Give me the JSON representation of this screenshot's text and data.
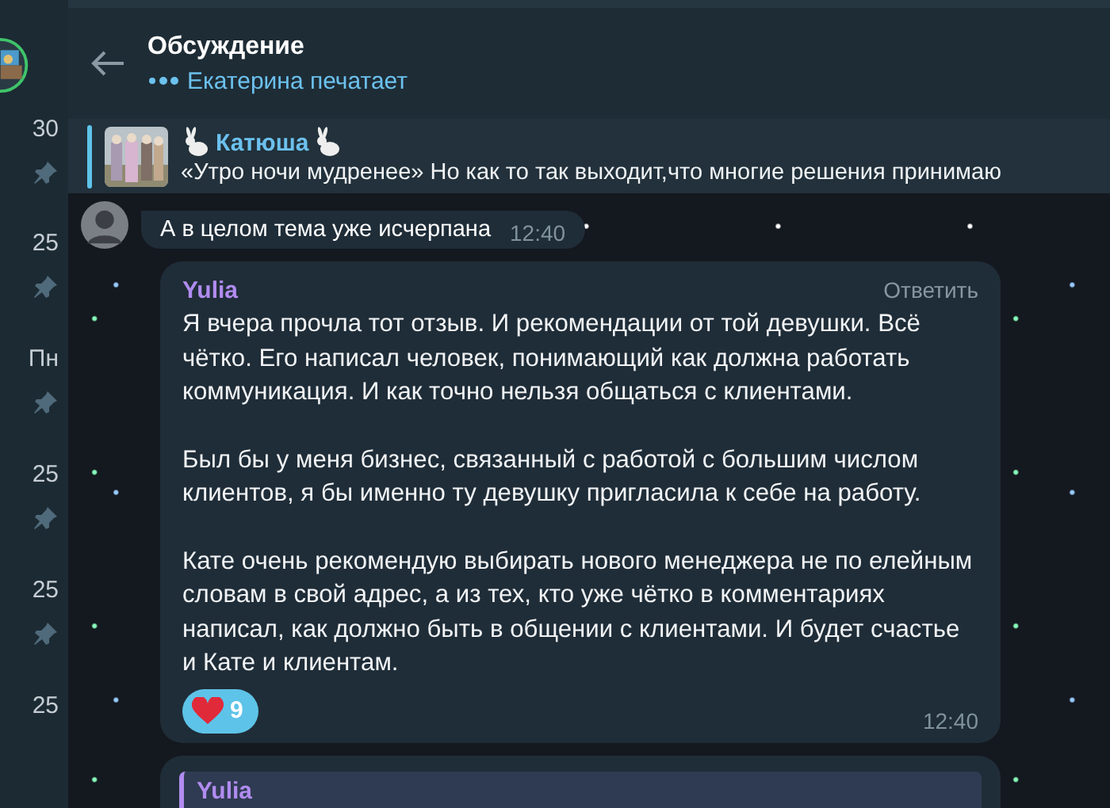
{
  "header": {
    "title": "Обсуждение",
    "status": "Екатерина печатает"
  },
  "sidebar": {
    "items": [
      {
        "time": "30",
        "pinned": true
      },
      {
        "time": "25",
        "pinned": true
      },
      {
        "time": "Пн",
        "pinned": true
      },
      {
        "time": "25",
        "pinned": true
      },
      {
        "time": "25",
        "pinned": true
      },
      {
        "time": "25",
        "pinned": false
      }
    ]
  },
  "pinned": {
    "name": "Катюша",
    "text": "«Утро ночи мудренее»  Но как то так выходит,что многие решения принимаю"
  },
  "messages": [
    {
      "kind": "partial",
      "text": "А в целом тема уже исчерпана",
      "time": "12:40"
    },
    {
      "kind": "full",
      "author": "Yulia",
      "reply_label": "Ответить",
      "paragraphs": [
        "Я вчера прочла тот отзыв. И рекомендации от той девушки. Всё чётко. Его написал человек, понимающий как должна работать коммуникация. И как точно нельзя общаться с клиентами.",
        "Был бы у меня бизнес, связанный с работой с большим числом клиентов, я бы именно ту девушку пригласила к себе на работу.",
        "Кате очень рекомендую выбирать нового менеджера не по елейным словам в свой адрес, а из тех, кто уже чётко в комментариях написал, как должно быть в общении с клиентами. И будет счастье и Кате и клиентам."
      ],
      "reaction": {
        "count": "9",
        "selected": true
      },
      "time": "12:40"
    },
    {
      "kind": "quote",
      "quote_author": "Yulia"
    }
  ]
}
